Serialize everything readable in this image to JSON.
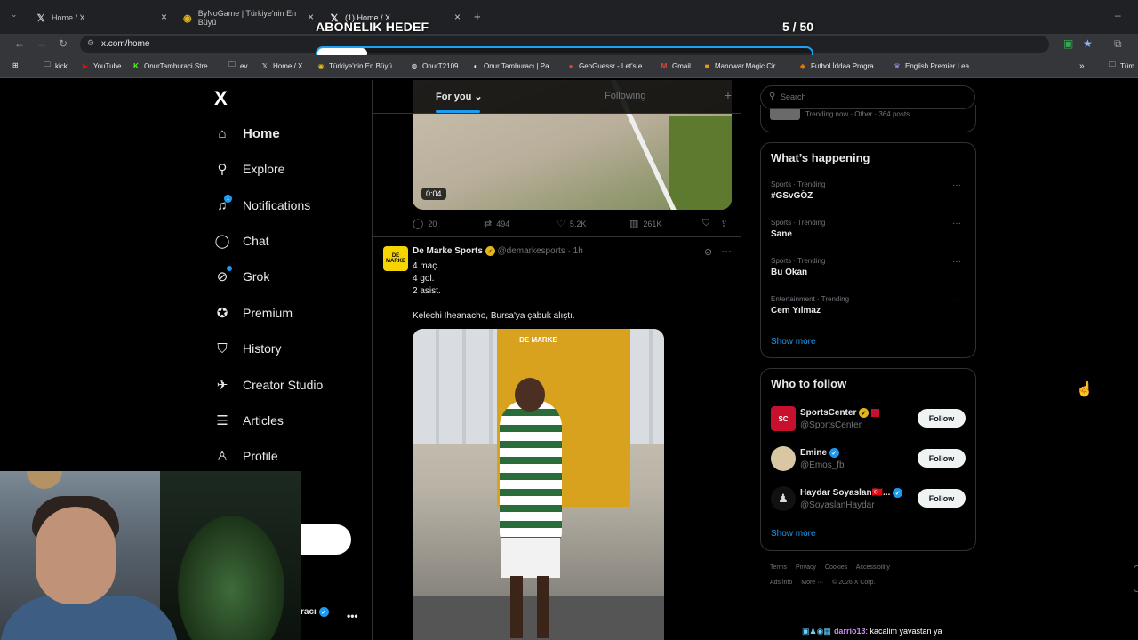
{
  "browser": {
    "tabs": [
      {
        "title": "Home / X",
        "icon": "x-logo-icon"
      },
      {
        "title": "ByNoGame | Türkiye'nin En Büyü",
        "icon": "bynogame-icon"
      },
      {
        "title": "(1) Home / X",
        "icon": "x-logo-icon"
      }
    ],
    "new_tab": "+",
    "url": "x.com/home",
    "bookmarks": [
      {
        "label": "kick",
        "icon": "folder-icon"
      },
      {
        "label": "YouTube",
        "icon": "youtube-icon"
      },
      {
        "label": "OnurTamburaci Stre...",
        "icon": "kick-icon"
      },
      {
        "label": "ev",
        "icon": "folder-icon"
      },
      {
        "label": "Home / X",
        "icon": "x-logo-icon"
      },
      {
        "label": "Türkiye'nin En Büyü...",
        "icon": "bynogame-icon"
      },
      {
        "label": "OnurT2109",
        "icon": "globe-icon"
      },
      {
        "label": "Onur Tamburacı | Pa...",
        "icon": "page-icon"
      },
      {
        "label": "GeoGuessr - Let's e...",
        "icon": "map-pin-icon"
      },
      {
        "label": "Gmail",
        "icon": "gmail-icon"
      },
      {
        "label": "Manowar.Magic.Cir...",
        "icon": "manowar-icon"
      },
      {
        "label": "Futbol İddaa Progra...",
        "icon": "football-icon"
      },
      {
        "label": "English Premier Lea...",
        "icon": "premier-league-icon"
      },
      {
        "label": "Tüm",
        "icon": "folder-icon"
      }
    ],
    "overflow": "»"
  },
  "overlay": {
    "title": "ABONELIK HEDEF",
    "count": "5 / 50",
    "progress": 0.1
  },
  "nav": {
    "logo": "X",
    "items": [
      {
        "label": "Home",
        "icon": "home-icon"
      },
      {
        "label": "Explore",
        "icon": "search-icon"
      },
      {
        "label": "Notifications",
        "icon": "bell-icon",
        "badge": "1"
      },
      {
        "label": "Chat",
        "icon": "chat-icon"
      },
      {
        "label": "Grok",
        "icon": "grok-icon"
      },
      {
        "label": "Premium",
        "icon": "premium-icon"
      },
      {
        "label": "History",
        "icon": "bookmark-icon"
      },
      {
        "label": "Creator Studio",
        "icon": "rocket-icon"
      },
      {
        "label": "Articles",
        "icon": "articles-icon"
      },
      {
        "label": "Profile",
        "icon": "person-icon"
      }
    ],
    "account_name": "racı",
    "more": "•••"
  },
  "feed": {
    "tabs": [
      {
        "label": "For you"
      },
      {
        "label": "Following"
      }
    ],
    "add": "+",
    "video": {
      "time": "0:04"
    },
    "prev_actions": {
      "replies": "20",
      "reposts": "494",
      "likes": "5.2K",
      "views": "261K"
    },
    "tweet": {
      "avatar_text": "DE MARKE",
      "name": "De Marke Sports",
      "handle": "@demarkesports · 1h",
      "lines": [
        "4 maç.",
        "4 gol.",
        "2 asist.",
        "",
        "Kelechi Iheanacho, Bursa'ya çabuk alıştı."
      ],
      "image_logo": "DE MARKE"
    }
  },
  "sidebar": {
    "search_placeholder": "Search",
    "top_trend_meta": "Trending now · Other · 364 posts",
    "happening": {
      "title": "What’s happening",
      "trends": [
        {
          "meta": "Sports · Trending",
          "name": "#GSvGÖZ"
        },
        {
          "meta": "Sports · Trending",
          "name": "Sane"
        },
        {
          "meta": "Sports · Trending",
          "name": "Bu Okan"
        },
        {
          "meta": "Entertainment · Trending",
          "name": "Cem Yılmaz"
        }
      ],
      "show_more": "Show more"
    },
    "who_to_follow": {
      "title": "Who to follow",
      "accounts": [
        {
          "name": "SportsCenter",
          "handle": "@SportsCenter",
          "button": "Follow",
          "avatar_color": "#c8102e"
        },
        {
          "name": "Emine",
          "handle": "@Emos_fb",
          "button": "Follow",
          "avatar_color": "#d9c7a4"
        },
        {
          "name": "Haydar Soyaslan🇹🇷...",
          "handle": "@SoyaslanHaydar",
          "button": "Follow",
          "avatar_color": "#1a1a1a"
        }
      ],
      "show_more": "Show more"
    },
    "footer": {
      "line1": [
        "Terms",
        "Privacy",
        "Cookies",
        "Accessibility"
      ],
      "line2": [
        "Ads info",
        "More ···",
        "© 2026 X Corp."
      ]
    }
  },
  "stream_chat": {
    "user": "darrio13",
    "message": ": kacalim yavastan ya"
  },
  "colors": {
    "accent": "#1d9bf0",
    "background": "#000000",
    "border": "#2f3336",
    "muted": "#71767b"
  }
}
